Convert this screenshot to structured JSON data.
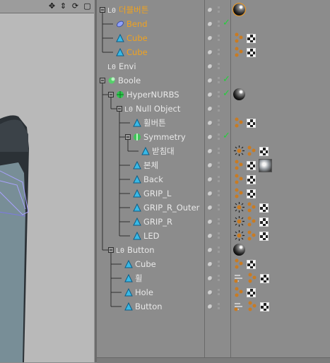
{
  "colors": {
    "selected_text": "#f0a21f",
    "text": "#e8e8e8",
    "check": "#22d03a"
  },
  "viewport": {
    "toolbar_icons": [
      "move-view-icon",
      "move-vertical-icon",
      "rotate-view-icon",
      "maximize-view-icon"
    ],
    "toolbar_glyphs": [
      "✥",
      "⇕",
      "⟳",
      "▢"
    ]
  },
  "objects": [
    {
      "label": "더블버튼",
      "level": 0,
      "icon": "null",
      "orange": true,
      "check": false,
      "tags": [
        "material-selected"
      ]
    },
    {
      "label": "Bend",
      "level": 1,
      "icon": "deformer",
      "orange": true,
      "check": true,
      "tags": []
    },
    {
      "label": "Cube",
      "level": 1,
      "icon": "poly",
      "orange": true,
      "check": false,
      "tags": [
        "phong",
        "texture"
      ]
    },
    {
      "label": "Cube",
      "level": 1,
      "icon": "poly",
      "orange": true,
      "check": false,
      "tags": [
        "phong",
        "texture"
      ]
    },
    {
      "label": "Envi",
      "level": 0,
      "icon": "null",
      "orange": false,
      "check": false,
      "tags": []
    },
    {
      "label": "Boole",
      "level": 0,
      "icon": "boole",
      "orange": false,
      "check": true,
      "tags": []
    },
    {
      "label": "HyperNURBS",
      "level": 1,
      "icon": "hypernurbs",
      "orange": false,
      "check": true,
      "tags": [
        "material"
      ]
    },
    {
      "label": "Null Object",
      "level": 2,
      "icon": "null",
      "orange": false,
      "check": false,
      "tags": []
    },
    {
      "label": "휠버튼",
      "level": 3,
      "icon": "poly",
      "orange": false,
      "check": false,
      "tags": [
        "phong",
        "texture"
      ]
    },
    {
      "label": "Symmetry",
      "level": 3,
      "icon": "symmetry",
      "orange": false,
      "check": true,
      "tags": []
    },
    {
      "label": "받침대",
      "level": 4,
      "icon": "poly",
      "orange": false,
      "check": false,
      "tags": [
        "sun",
        "phong",
        "texture"
      ]
    },
    {
      "label": "본체",
      "level": 3,
      "icon": "poly",
      "orange": false,
      "check": false,
      "tags": [
        "phong",
        "texture",
        "shade"
      ]
    },
    {
      "label": "Back",
      "level": 3,
      "icon": "poly",
      "orange": false,
      "check": false,
      "tags": [
        "phong",
        "texture"
      ]
    },
    {
      "label": "GRIP_L",
      "level": 3,
      "icon": "poly",
      "orange": false,
      "check": false,
      "tags": [
        "phong",
        "texture"
      ]
    },
    {
      "label": "GRIP_R_Outer",
      "level": 3,
      "icon": "poly",
      "orange": false,
      "check": false,
      "tags": [
        "sun",
        "phong",
        "texture"
      ]
    },
    {
      "label": "GRIP_R",
      "level": 3,
      "icon": "poly",
      "orange": false,
      "check": false,
      "tags": [
        "sun",
        "phong",
        "texture"
      ]
    },
    {
      "label": "LED",
      "level": 3,
      "icon": "poly",
      "orange": false,
      "check": false,
      "tags": [
        "sun",
        "phong",
        "texture"
      ]
    },
    {
      "label": "Button",
      "level": 1,
      "icon": "null",
      "orange": false,
      "check": false,
      "tags": [
        "material"
      ]
    },
    {
      "label": "Cube",
      "level": 2,
      "icon": "poly",
      "orange": false,
      "check": false,
      "tags": [
        "phong",
        "texture"
      ]
    },
    {
      "label": "휠",
      "level": 2,
      "icon": "poly",
      "orange": false,
      "check": false,
      "tags": [
        "lines",
        "phong",
        "texture"
      ]
    },
    {
      "label": "Hole",
      "level": 2,
      "icon": "poly",
      "orange": false,
      "check": false,
      "tags": [
        "phong",
        "texture"
      ]
    },
    {
      "label": "Button",
      "level": 2,
      "icon": "poly",
      "orange": false,
      "check": false,
      "tags": [
        "lines",
        "phong",
        "texture"
      ]
    }
  ]
}
